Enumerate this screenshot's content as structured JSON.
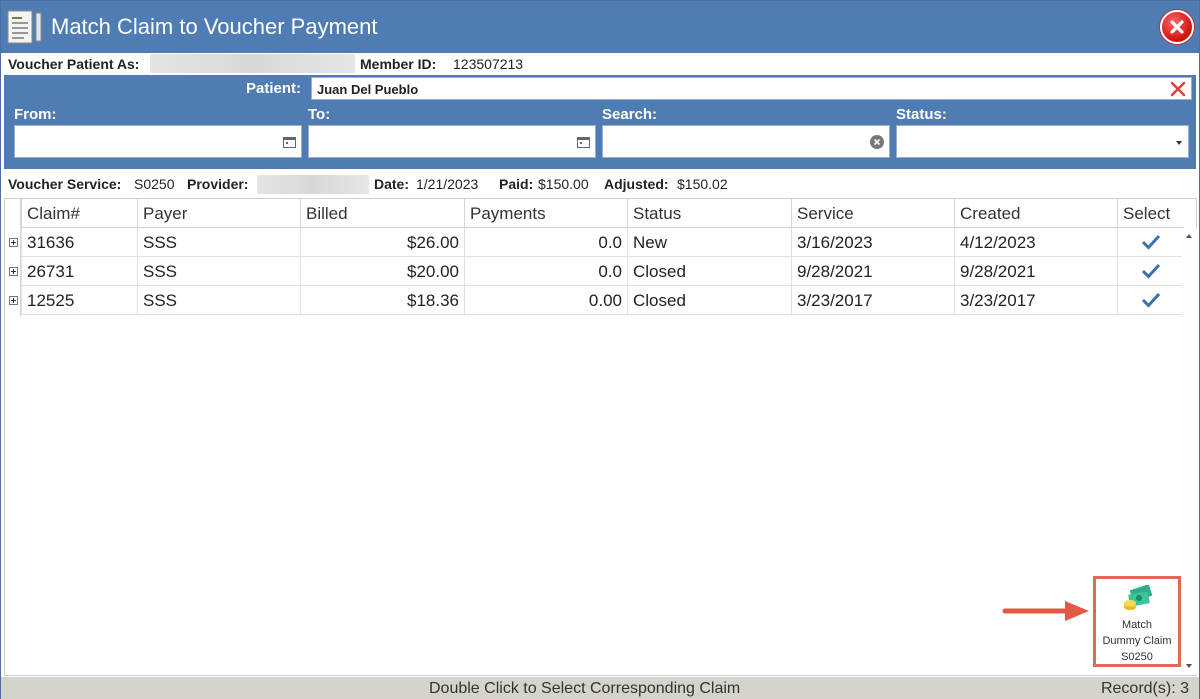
{
  "window": {
    "title": "Match Claim to Voucher Payment",
    "icons": {
      "app": "document-list-icon",
      "close": "close-icon"
    }
  },
  "voucher_patient": {
    "label": "Voucher Patient As:",
    "member_label": "Member ID:",
    "member_id": "123507213"
  },
  "filters": {
    "patient_label": "Patient:",
    "patient_value": "Juan Del Pueblo",
    "from_label": "From:",
    "to_label": "To:",
    "search_label": "Search:",
    "status_label": "Status:",
    "from_value": "",
    "to_value": "",
    "search_value": "",
    "status_value": ""
  },
  "service": {
    "service_label": "Voucher Service:",
    "service_value": "S0250",
    "provider_label": "Provider:",
    "date_label": "Date:",
    "date_value": "1/21/2023",
    "paid_label": "Paid:",
    "paid_value": "$150.00",
    "adjusted_label": "Adjusted:",
    "adjusted_value": "$150.02"
  },
  "grid": {
    "columns": [
      "Claim#",
      "Payer",
      "Billed",
      "Payments",
      "Status",
      "Service",
      "Created",
      "Select"
    ],
    "rows": [
      {
        "claim": "31636",
        "payer": "SSS",
        "billed": "$26.00",
        "payments": "0.0",
        "status": "New",
        "service": "3/16/2023",
        "created": "4/12/2023",
        "selected": true
      },
      {
        "claim": "26731",
        "payer": "SSS",
        "billed": "$20.00",
        "payments": "0.0",
        "status": "Closed",
        "service": "9/28/2021",
        "created": "9/28/2021",
        "selected": true
      },
      {
        "claim": "12525",
        "payer": "SSS",
        "billed": "$18.36",
        "payments": "0.00",
        "status": "Closed",
        "service": "3/23/2017",
        "created": "3/23/2017",
        "selected": true
      }
    ]
  },
  "match_button": {
    "line1": "Match",
    "line2": "Dummy Claim",
    "line3": "S0250",
    "icon": "money-stack-icon"
  },
  "statusbar": {
    "hint": "Double Click to Select Corresponding Claim",
    "records": "Record(s): 3"
  },
  "colors": {
    "titlebar": "#4f7db3",
    "accent_highlight": "#e06a5a",
    "check": "#3a6fb0"
  }
}
